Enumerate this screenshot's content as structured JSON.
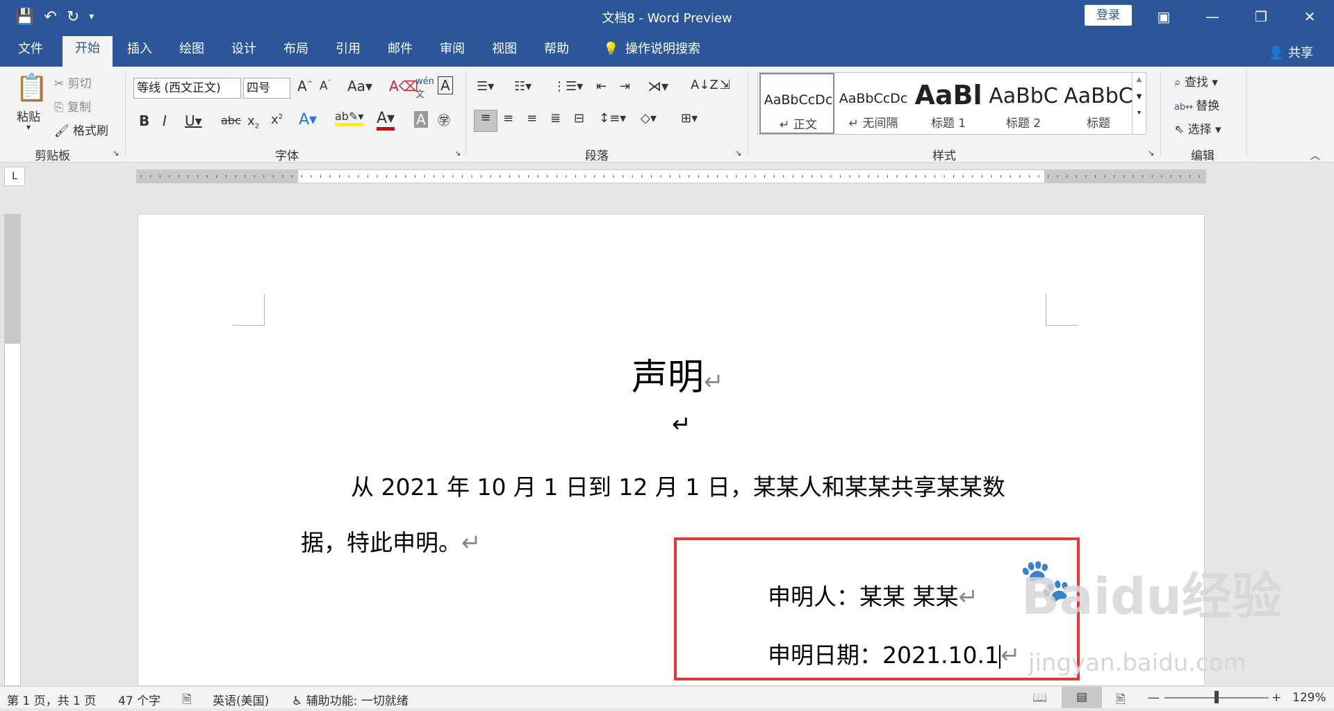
{
  "window": {
    "title": "文档8  -  Word Preview",
    "login": "登录"
  },
  "tabs": [
    {
      "label": "文件"
    },
    {
      "label": "开始"
    },
    {
      "label": "插入"
    },
    {
      "label": "绘图"
    },
    {
      "label": "设计"
    },
    {
      "label": "布局"
    },
    {
      "label": "引用"
    },
    {
      "label": "邮件"
    },
    {
      "label": "审阅"
    },
    {
      "label": "视图"
    },
    {
      "label": "帮助"
    },
    {
      "label": "操作说明搜索"
    }
  ],
  "share": "共享",
  "clipboard": {
    "paste": "粘贴",
    "cut": "剪切",
    "copy": "复制",
    "format_painter": "格式刷",
    "group": "剪贴板"
  },
  "font": {
    "name": "等线 (西文正文)",
    "size": "四号",
    "group": "字体"
  },
  "paragraph": {
    "group": "段落"
  },
  "styles": {
    "group": "样式",
    "items": [
      {
        "sample": "AaBbCcDc",
        "name": "↵ 正文"
      },
      {
        "sample": "AaBbCcDc",
        "name": "↵ 无间隔"
      },
      {
        "sample": "AaBl",
        "name": "标题 1"
      },
      {
        "sample": "AaBbC",
        "name": "标题 2"
      },
      {
        "sample": "AaBbC",
        "name": "标题"
      }
    ]
  },
  "editing": {
    "find": "查找",
    "replace": "替换",
    "select": "选择",
    "group": "编辑"
  },
  "document": {
    "title": "声明",
    "line1": "从 2021 年 10 月 1 日到 12 月 1 日，某某人和某某共享某某数",
    "line2": "据，特此申明。",
    "declarant": "申明人：某某  某某",
    "date": "申明日期：2021.10.1"
  },
  "watermark": {
    "main": "Baidu经验",
    "sub": "jingyan.baidu.com"
  },
  "status": {
    "page": "第 1 页，共 1 页",
    "words": "47 个字",
    "language": "英语(美国)",
    "accessibility": "辅助功能: 一切就绪",
    "zoom": "129%"
  }
}
